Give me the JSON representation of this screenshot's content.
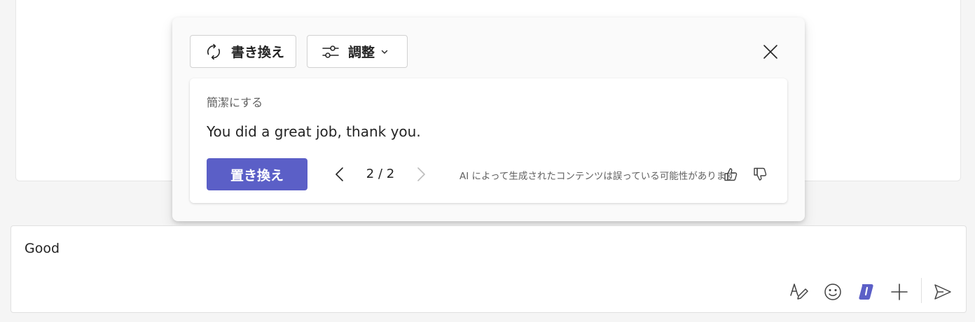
{
  "background_card": {},
  "rewrite_panel": {
    "rewrite_label": "書き換え",
    "adjust_label": "調整",
    "suggestion": {
      "style_label": "簡潔にする",
      "text": "You did a great job, thank you."
    },
    "replace_label": "置き換え",
    "pagination": "2 / 2",
    "disclaimer": "AI によって生成されたコンテンツは誤っている可能性があります"
  },
  "compose": {
    "text": "Good"
  },
  "colors": {
    "accent": "#5b5fc7",
    "background": "#f5f5f5",
    "surface": "#ffffff"
  },
  "icons": [
    "refresh-icon",
    "sliders-icon",
    "chevron-down-icon",
    "close-icon",
    "chevron-left-icon",
    "chevron-right-icon",
    "thumbs-up-icon",
    "thumbs-down-icon",
    "format-icon",
    "emoji-icon",
    "copilot-icon",
    "plus-icon",
    "send-icon"
  ]
}
